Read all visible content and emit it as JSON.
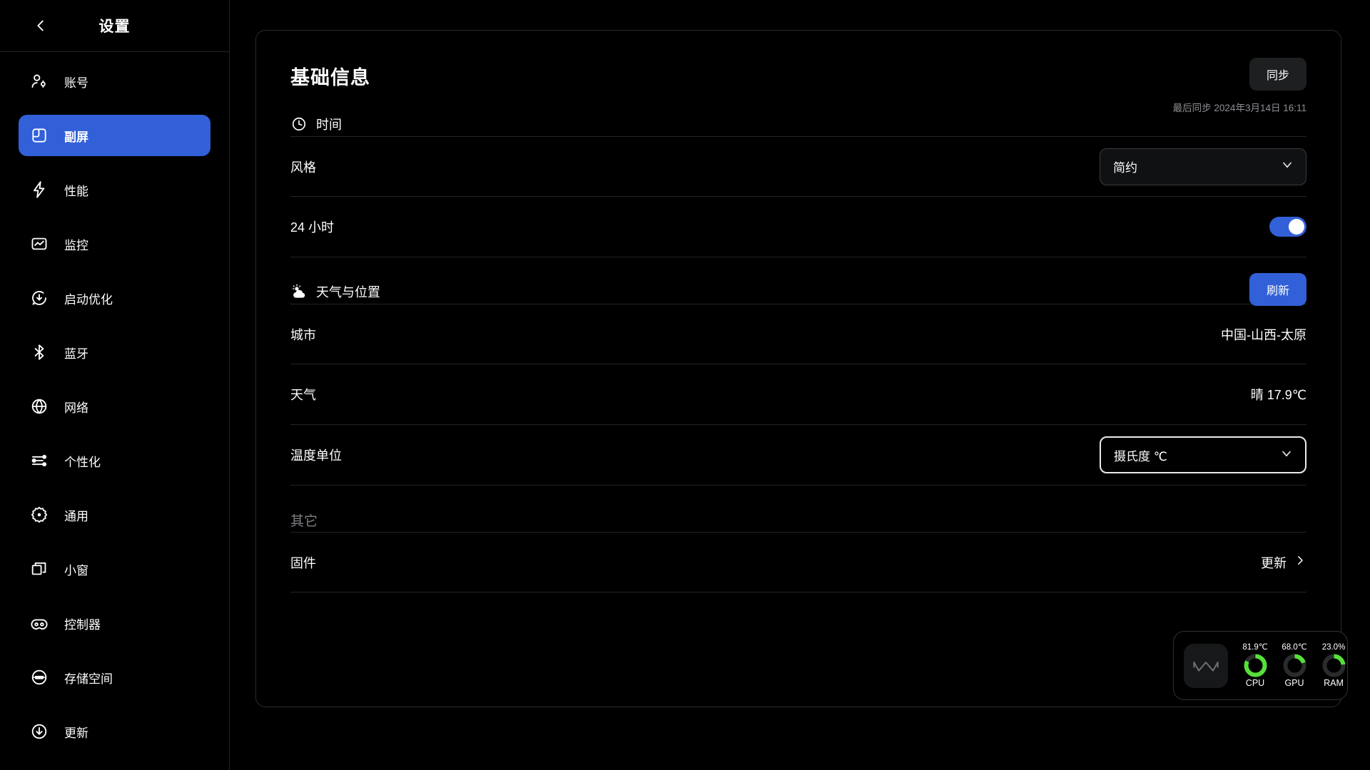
{
  "sidebar": {
    "back_icon": "chevron-left-icon",
    "title": "设置",
    "items": [
      {
        "label": "账号",
        "icon": "user-account-icon",
        "active": false
      },
      {
        "label": "副屏",
        "icon": "second-screen-icon",
        "active": true
      },
      {
        "label": "性能",
        "icon": "lightning-bolt-icon",
        "active": false
      },
      {
        "label": "监控",
        "icon": "monitoring-chart-icon",
        "active": false
      },
      {
        "label": "启动优化",
        "icon": "boot-optimize-icon",
        "active": false
      },
      {
        "label": "蓝牙",
        "icon": "bluetooth-icon",
        "active": false
      },
      {
        "label": "网络",
        "icon": "globe-network-icon",
        "active": false
      },
      {
        "label": "个性化",
        "icon": "sliders-icon",
        "active": false
      },
      {
        "label": "通用",
        "icon": "gear-icon",
        "active": false
      },
      {
        "label": "小窗",
        "icon": "windows-stack-icon",
        "active": false
      },
      {
        "label": "控制器",
        "icon": "gamepad-icon",
        "active": false
      },
      {
        "label": "存储空间",
        "icon": "storage-disk-icon",
        "active": false
      },
      {
        "label": "更新",
        "icon": "download-update-icon",
        "active": false
      }
    ]
  },
  "main": {
    "card_title": "基础信息",
    "sync_button": "同步",
    "sync_timestamp": "最后同步 2024年3月14日 16:11",
    "sections": {
      "time": {
        "icon": "clock-icon",
        "label": "时间",
        "rows": [
          {
            "label": "风格",
            "type": "select",
            "value": "简约",
            "focused": false
          },
          {
            "label": "24 小时",
            "type": "toggle",
            "value": "on"
          }
        ]
      },
      "weather": {
        "icon": "sun-cloud-icon",
        "label": "天气与位置",
        "action_button": "刷新",
        "rows": [
          {
            "label": "城市",
            "type": "text",
            "value": "中国-山西-太原"
          },
          {
            "label": "天气",
            "type": "text",
            "value": "晴 17.9℃"
          },
          {
            "label": "温度单位",
            "type": "select",
            "value": "摄氏度 ℃",
            "focused": true
          }
        ]
      },
      "other": {
        "label": "其它",
        "rows": [
          {
            "label": "固件",
            "type": "link",
            "value": "更新",
            "icon": "chevron-right-icon"
          }
        ]
      }
    }
  },
  "monitor_widget": {
    "logo_icon": "brand-m-logo-icon",
    "accent_color": "#56e03a",
    "gauges": [
      {
        "name": "CPU",
        "value": "81.9℃",
        "percent": 82
      },
      {
        "name": "GPU",
        "value": "68.0℃",
        "percent": 20
      },
      {
        "name": "RAM",
        "value": "23.0%",
        "percent": 23
      }
    ]
  }
}
